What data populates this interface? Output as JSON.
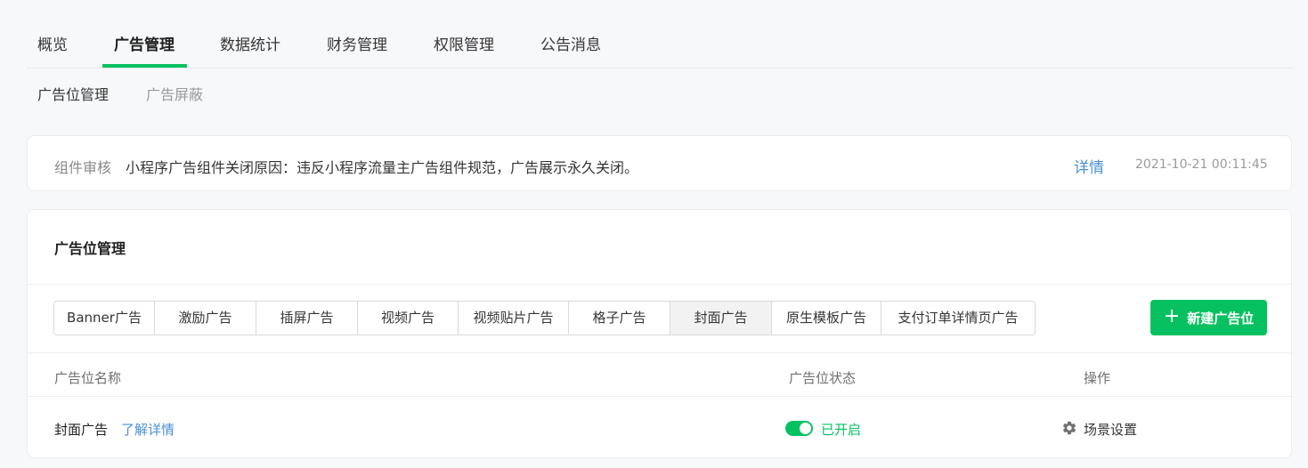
{
  "top_nav": {
    "tabs": [
      "概览",
      "广告管理",
      "数据统计",
      "财务管理",
      "权限管理",
      "公告消息"
    ],
    "active_index": 1
  },
  "sub_nav": {
    "items": [
      "广告位管理",
      "广告屏蔽"
    ],
    "active_index": 0
  },
  "notice": {
    "tag": "组件审核",
    "message": "小程序广告组件关闭原因：违反小程序流量主广告组件规范，广告展示永久关闭。",
    "detail_link": "详情",
    "timestamp": "2021-10-21 00:11:45"
  },
  "ad_slots": {
    "title": "广告位管理",
    "ad_types": [
      "Banner广告",
      "激励广告",
      "插屏广告",
      "视频广告",
      "视频贴片广告",
      "格子广告",
      "封面广告",
      "原生模板广告",
      "支付订单详情页广告"
    ],
    "active_type_index": 6,
    "new_button": "新建广告位",
    "columns": {
      "name": "广告位名称",
      "status": "广告位状态",
      "actions": "操作"
    },
    "rows": [
      {
        "name": "封面广告",
        "learn_more": "了解详情",
        "enabled": true,
        "status": "已开启",
        "action": "场景设置"
      }
    ]
  },
  "colors": {
    "accent": "#07c160",
    "link": "#4a8fd3"
  },
  "icons": {
    "new_button": "plus-icon",
    "action": "gear-icon"
  }
}
